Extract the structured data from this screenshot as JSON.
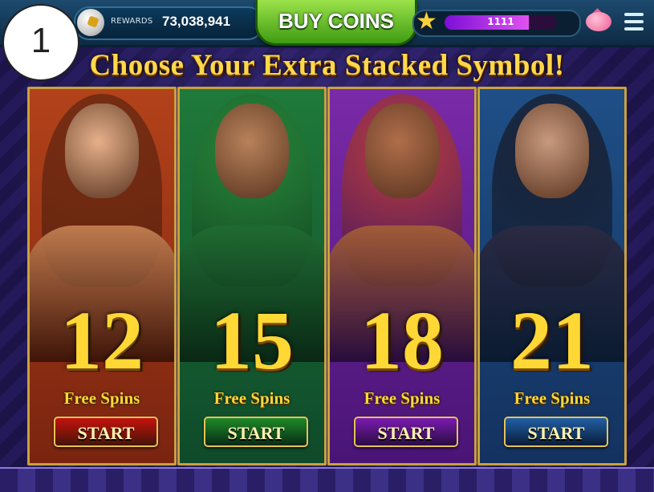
{
  "step_badge": "1",
  "topbar": {
    "rewards_label": "REWARDS",
    "rewards_value": "73,038,941",
    "buy_coins_label": "BUY COINS",
    "level_value": "1111",
    "level_progress_fraction": 0.75
  },
  "title": "Choose Your Extra Stacked Symbol!",
  "cards": [
    {
      "spins": "12",
      "spins_label": "Free Spins",
      "start_label": "START",
      "bg_top": "#b3421a",
      "bg_bottom": "#7a2410",
      "skin": "#e6b08a",
      "hair": "#6a2a12",
      "torso": "#c07a4e",
      "button": "#c4120c"
    },
    {
      "spins": "15",
      "spins_label": "Free Spins",
      "start_label": "START",
      "bg_top": "#1f7a3a",
      "bg_bottom": "#0f4a2a",
      "skin": "#b8825a",
      "hair": "#2a8a3a",
      "torso": "#1f6a32",
      "button": "#1e8a26"
    },
    {
      "spins": "18",
      "spins_label": "Free Spins",
      "start_label": "START",
      "bg_top": "#7a2aa8",
      "bg_bottom": "#4a1476",
      "skin": "#b06e4a",
      "hair": "#c4402a",
      "torso": "#a05a3a",
      "button": "#7a1ab0"
    },
    {
      "spins": "21",
      "spins_label": "Free Spins",
      "start_label": "START",
      "bg_top": "#1e4f86",
      "bg_bottom": "#143260",
      "skin": "#c89a7e",
      "hair": "#1a1a28",
      "torso": "#2a2a44",
      "button": "#1f5fa6"
    }
  ]
}
